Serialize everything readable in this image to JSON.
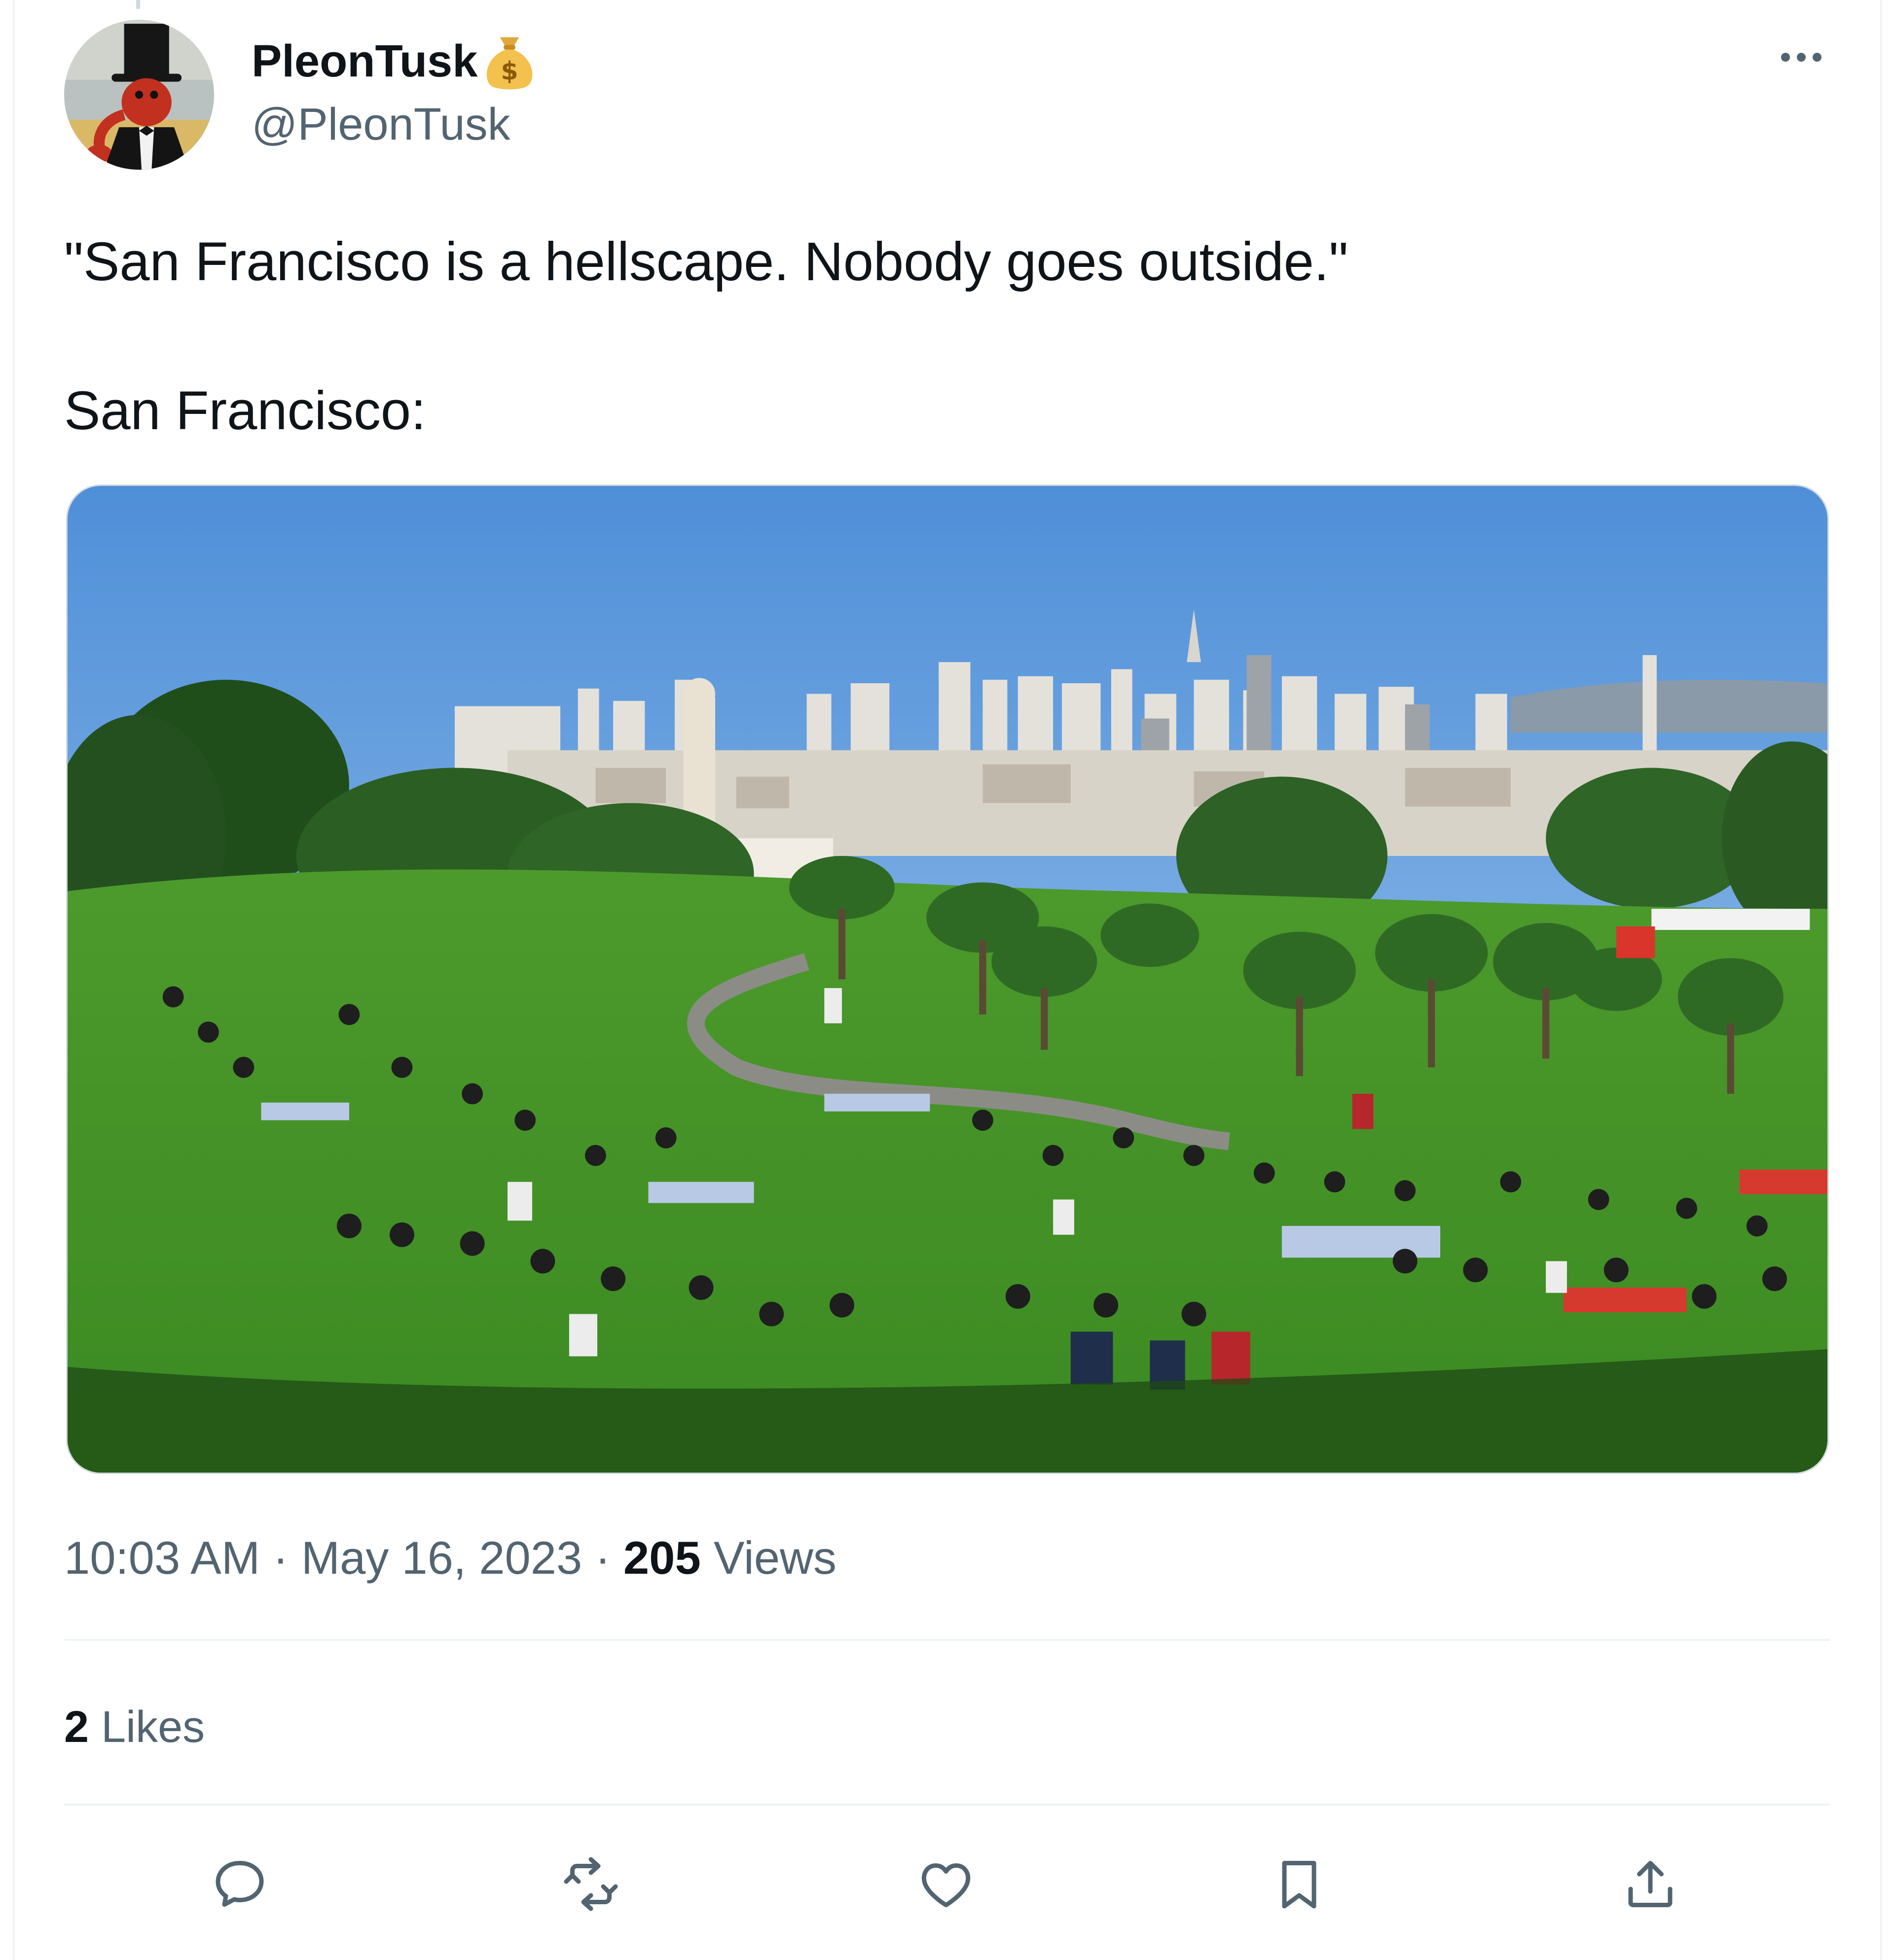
{
  "author": {
    "display_name": "PleonTusk",
    "badge_icon": "moneybag-icon",
    "handle": "@PleonTusk",
    "avatar_icon": "lobster-in-top-hat-avatar"
  },
  "tweet": {
    "text_line1": "\"San Francisco is a hellscape. Nobody goes outside.\"",
    "text_line2": "San Francisco:"
  },
  "meta": {
    "time": "10:03 AM",
    "separator": "·",
    "date": "May 16, 2023",
    "views_count": "205",
    "views_label": "Views"
  },
  "engagement": {
    "likes_count": "2",
    "likes_label": "Likes"
  },
  "actions": {
    "reply_icon": "reply-icon",
    "retweet_icon": "retweet-icon",
    "like_icon": "heart-icon",
    "bookmark_icon": "bookmark-icon",
    "share_icon": "share-icon"
  },
  "colors": {
    "text_primary": "#0f1419",
    "text_secondary": "#536471",
    "divider": "#eff3f4"
  }
}
